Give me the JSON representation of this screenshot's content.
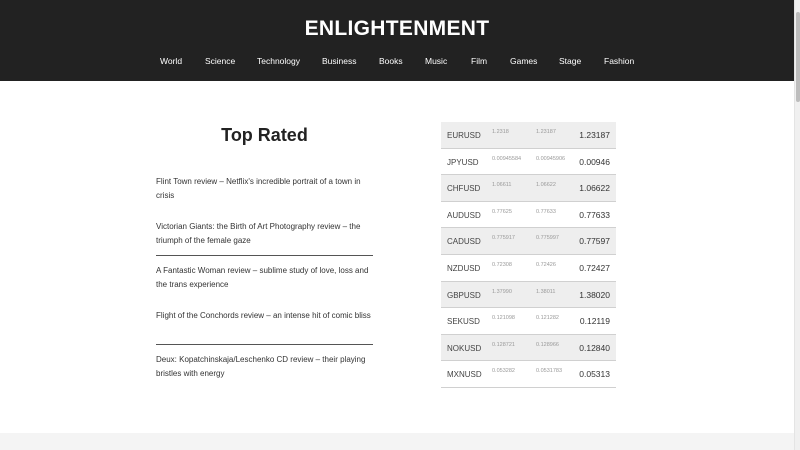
{
  "header": {
    "title": "ENLIGHTENMENT",
    "nav": [
      "World",
      "Science",
      "Technology",
      "Business",
      "Books",
      "Music",
      "Film",
      "Games",
      "Stage",
      "Fashion"
    ]
  },
  "top_rated": {
    "heading": "Top Rated",
    "articles": [
      "Flint Town review – Netflix's incredible portrait of a town in crisis",
      "Victorian Giants: the Birth of Art Photography review – the triumph of the female gaze",
      "A Fantastic Woman review – sublime study of love, loss and the trans experience",
      "Flight of the Conchords review – an intense hit of comic bliss",
      "Deux: Kopatchinskaja/Leschenko CD review – their playing bristles with energy"
    ]
  },
  "fx_table": {
    "rows": [
      {
        "pair": "EURUSD",
        "bid": "1.2318",
        "ask": "1.23187",
        "rate": "1.23187"
      },
      {
        "pair": "JPYUSD",
        "bid": "0.00945584",
        "ask": "0.00945906",
        "rate": "0.00946"
      },
      {
        "pair": "CHFUSD",
        "bid": "1.06611",
        "ask": "1.06622",
        "rate": "1.06622"
      },
      {
        "pair": "AUDUSD",
        "bid": "0.77625",
        "ask": "0.77633",
        "rate": "0.77633"
      },
      {
        "pair": "CADUSD",
        "bid": "0.775917",
        "ask": "0.775997",
        "rate": "0.77597"
      },
      {
        "pair": "NZDUSD",
        "bid": "0.72308",
        "ask": "0.72426",
        "rate": "0.72427"
      },
      {
        "pair": "GBPUSD",
        "bid": "1.37990",
        "ask": "1.38011",
        "rate": "1.38020"
      },
      {
        "pair": "SEKUSD",
        "bid": "0.121098",
        "ask": "0.121282",
        "rate": "0.12119"
      },
      {
        "pair": "NOKUSD",
        "bid": "0.128721",
        "ask": "0.128966",
        "rate": "0.12840"
      },
      {
        "pair": "MXNUSD",
        "bid": "0.053282",
        "ask": "0.0531783",
        "rate": "0.05313"
      }
    ]
  }
}
